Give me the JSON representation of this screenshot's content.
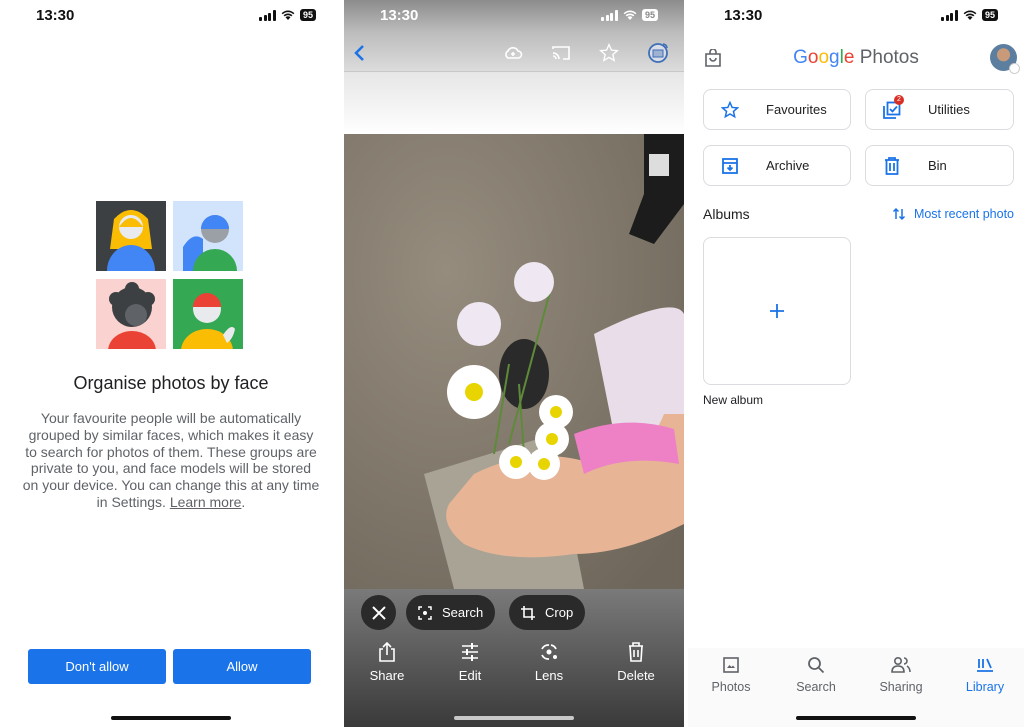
{
  "status_bar": {
    "time": "13:30",
    "battery": "95"
  },
  "face_dialog": {
    "title": "Organise photos by face",
    "body": "Your favourite people will be automatically grouped by similar faces, which makes it easy to search for photos of them. These groups are private to you, and face models will be stored on your device. You can change this at any time in Settings. ",
    "learn_more": "Learn more",
    "period": ".",
    "dont_allow": "Don't allow",
    "allow": "Allow"
  },
  "viewer": {
    "top_icons": [
      "back-icon",
      "cloud-upload-icon",
      "cast-icon",
      "star-icon",
      "profile-icon"
    ],
    "chips": {
      "search": "Search",
      "crop": "Crop"
    },
    "actions": [
      {
        "label": "Share",
        "icon": "share-icon"
      },
      {
        "label": "Edit",
        "icon": "edit-sliders-icon"
      },
      {
        "label": "Lens",
        "icon": "lens-icon"
      },
      {
        "label": "Delete",
        "icon": "trash-icon"
      }
    ]
  },
  "library": {
    "logo_google": "Google",
    "logo_photos": " Photos",
    "cards": [
      {
        "label": "Favourites",
        "icon": "star-icon"
      },
      {
        "label": "Utilities",
        "icon": "utilities-icon",
        "badge": "2"
      },
      {
        "label": "Archive",
        "icon": "archive-icon"
      },
      {
        "label": "Bin",
        "icon": "trash-icon"
      }
    ],
    "albums_heading": "Albums",
    "sort_label": "Most recent photo",
    "new_album": "New album",
    "nav": [
      {
        "label": "Photos",
        "active": false
      },
      {
        "label": "Search",
        "active": false
      },
      {
        "label": "Sharing",
        "active": false
      },
      {
        "label": "Library",
        "active": true
      }
    ],
    "colors": {
      "accent": "#1a73e8",
      "badge": "#d93025"
    }
  }
}
